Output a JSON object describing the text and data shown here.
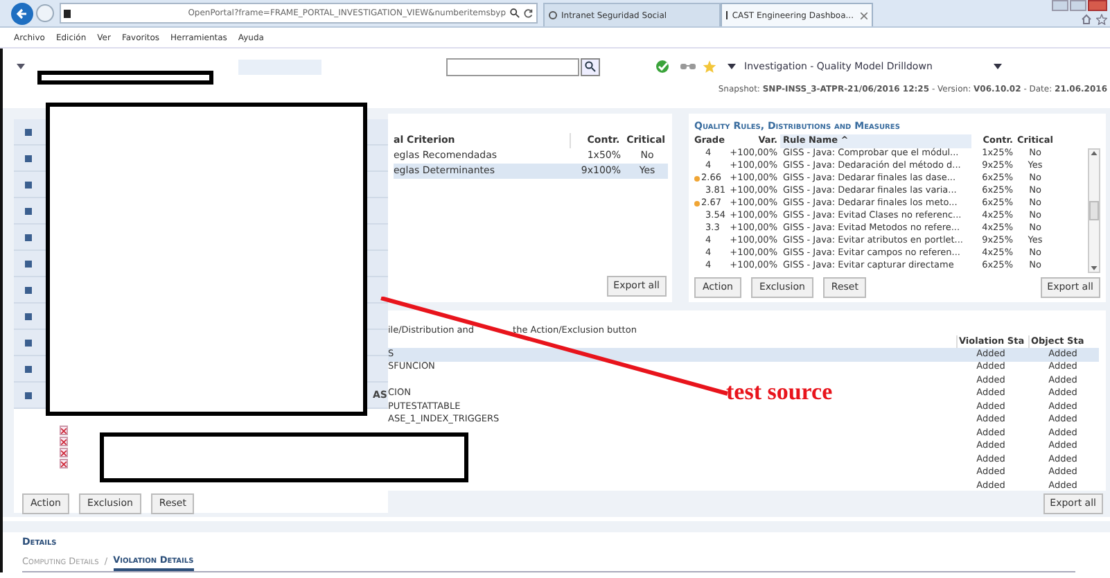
{
  "browser": {
    "address": "OpenPortal?frame=FRAME_PORTAL_INVESTIGATION_VIEW&numberitemsbyp",
    "tabs": [
      {
        "label": "Intranet Seguridad Social",
        "selected": false
      },
      {
        "label": "CAST Engineering Dashboa...",
        "selected": true
      }
    ],
    "menu": [
      "Archivo",
      "Edición",
      "Ver",
      "Favoritos",
      "Herramientas",
      "Ayuda"
    ]
  },
  "toolbar": {
    "view_title": "Investigation - Quality Model Drilldown",
    "snapshot": "Snapshot: **SNP-INSS_3-ATPR-21/06/2016 12:25** - Version: **V06.10.02** - Date: **21.06.2016**"
  },
  "sidebar": {
    "fragment": "AS"
  },
  "criteria_table": {
    "columns": [
      "al Criterion",
      "Contr.",
      "Critical"
    ],
    "rows": [
      {
        "name": "eglas Recomendadas",
        "contr": "1x50%",
        "critical": "No",
        "selected": false
      },
      {
        "name": "eglas Determinantes",
        "contr": "9x100%",
        "critical": "Yes",
        "selected": true
      }
    ],
    "export_button": "Export all"
  },
  "rules_panel": {
    "title": "Quality Rules, Distributions and Measures",
    "columns": [
      "Grade",
      "Var.",
      "Rule Name ^",
      "Contr.",
      "Critical"
    ],
    "rows": [
      {
        "grade": "4",
        "var": "+100,00%",
        "rule": "GISS - Java: Comprobar que el módul...",
        "contr": "1x25%",
        "critical": "No",
        "flagged": false
      },
      {
        "grade": "4",
        "var": "+100,00%",
        "rule": "GISS - Java: Dedaración del método d...",
        "contr": "9x25%",
        "critical": "Yes",
        "flagged": false
      },
      {
        "grade": "2.66",
        "var": "+100,00%",
        "rule": "GISS - Java: Dedarar finales las dase...",
        "contr": "6x25%",
        "critical": "No",
        "flagged": true
      },
      {
        "grade": "3.81",
        "var": "+100,00%",
        "rule": "GISS - Java: Dedarar finales las varia...",
        "contr": "6x25%",
        "critical": "No",
        "flagged": false
      },
      {
        "grade": "2.67",
        "var": "+100,00%",
        "rule": "GISS - Java: Dedarar finales los meto...",
        "contr": "6x25%",
        "critical": "No",
        "flagged": true
      },
      {
        "grade": "3.54",
        "var": "+100,00%",
        "rule": "GISS - Java: Evitad Clases no referenc...",
        "contr": "4x25%",
        "critical": "No",
        "flagged": false
      },
      {
        "grade": "3.3",
        "var": "+100,00%",
        "rule": "GISS - Java: Evitad Metodos no refere...",
        "contr": "4x25%",
        "critical": "No",
        "flagged": false
      },
      {
        "grade": "4",
        "var": "+100,00%",
        "rule": "GISS - Java: Evitar atributos en portlet...",
        "contr": "9x25%",
        "critical": "Yes",
        "flagged": false
      },
      {
        "grade": "4",
        "var": "+100,00%",
        "rule": "GISS - Java: Evitar campos no referen...",
        "contr": "4x25%",
        "critical": "No",
        "flagged": false
      },
      {
        "grade": "4",
        "var": "+100,00%",
        "rule": "GISS - Java: Evitar capturar directame",
        "contr": "6x25%",
        "critical": "No",
        "flagged": false
      }
    ],
    "buttons": [
      "Action",
      "Exclusion",
      "Reset"
    ],
    "export_button": "Export all"
  },
  "violations": {
    "hint_parts": [
      "ile/Distribution and",
      "the Action/Exclusion button"
    ],
    "columns": [
      "Violation Sta",
      "Object Sta"
    ],
    "rows": [
      {
        "column_1": "S",
        "violation_status": "Added",
        "object_status": "Added",
        "selected": true
      },
      {
        "column_1": "SFUNCION",
        "violation_status": "Added",
        "object_status": "Added",
        "selected": false
      },
      {
        "violation_status": "Added",
        "object_status": "Added",
        "selected": false
      },
      {
        "column_1": "CION",
        "violation_status": "Added",
        "object_status": "Added",
        "selected": false
      },
      {
        "column_1": "PUTESTATTABLE",
        "violation_status": "Added",
        "object_status": "Added",
        "selected": false
      },
      {
        "column_1": "ASE_1_INDEX_TRIGGERS",
        "violation_status": "Added",
        "object_status": "Added",
        "selected": false
      },
      {
        "violation_status": "Added",
        "object_status": "Added",
        "selected": false
      },
      {
        "violation_status": "Added",
        "object_status": "Added",
        "selected": false
      },
      {
        "violation_status": "Added",
        "object_status": "Added",
        "selected": false
      },
      {
        "violation_status": "Added",
        "object_status": "Added",
        "selected": false
      },
      {
        "violation_status": "Added",
        "object_status": "Added",
        "selected": false
      }
    ],
    "buttons": [
      "Action",
      "Exclusion",
      "Reset"
    ],
    "export_button": "Export all"
  },
  "details": {
    "title": "Details",
    "tabs": [
      {
        "label": "Computing Details",
        "selected": false
      },
      {
        "label": "Violation Details",
        "selected": true
      }
    ],
    "separator": "/"
  },
  "annotation": {
    "text": "test source"
  }
}
